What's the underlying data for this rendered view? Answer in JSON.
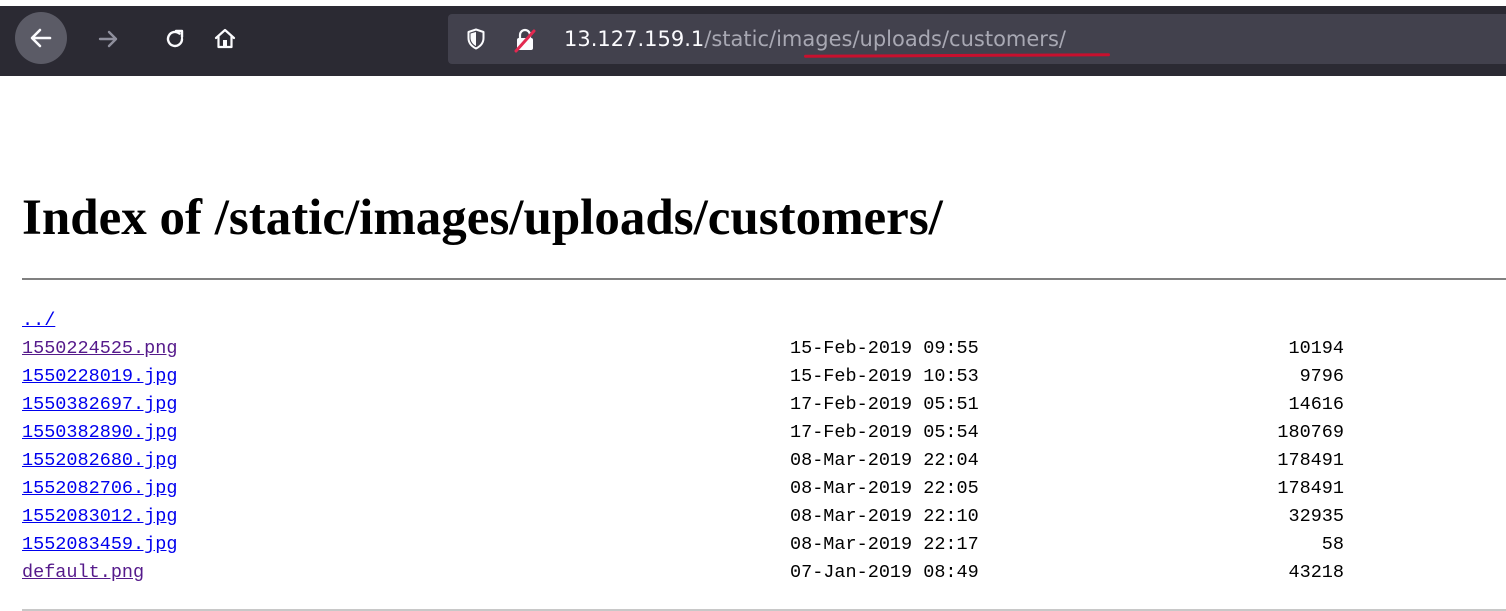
{
  "browser": {
    "url_host": "13.127.159.1",
    "url_path": "/static/images/uploads/customers/",
    "icons": {
      "back": "back-arrow-icon",
      "forward": "forward-arrow-icon",
      "reload": "reload-icon",
      "home": "home-icon",
      "tracking": "shield-icon",
      "security": "broken-lock-icon"
    }
  },
  "page": {
    "title": "Index of /static/images/uploads/customers/",
    "parent_link": "../",
    "files": [
      {
        "name": "1550224525.png",
        "date": "15-Feb-2019 09:55",
        "size": "10194",
        "visited": true
      },
      {
        "name": "1550228019.jpg",
        "date": "15-Feb-2019 10:53",
        "size": "9796",
        "visited": false
      },
      {
        "name": "1550382697.jpg",
        "date": "17-Feb-2019 05:51",
        "size": "14616",
        "visited": false
      },
      {
        "name": "1550382890.jpg",
        "date": "17-Feb-2019 05:54",
        "size": "180769",
        "visited": false
      },
      {
        "name": "1552082680.jpg",
        "date": "08-Mar-2019 22:04",
        "size": "178491",
        "visited": false
      },
      {
        "name": "1552082706.jpg",
        "date": "08-Mar-2019 22:05",
        "size": "178491",
        "visited": false
      },
      {
        "name": "1552083012.jpg",
        "date": "08-Mar-2019 22:10",
        "size": "32935",
        "visited": false
      },
      {
        "name": "1552083459.jpg",
        "date": "08-Mar-2019 22:17",
        "size": "58",
        "visited": false
      },
      {
        "name": "default.png",
        "date": "07-Jan-2019 08:49",
        "size": "43218",
        "visited": true
      }
    ]
  },
  "colors": {
    "toolbar_bg": "#2b2a33",
    "urlbar_bg": "#42414d",
    "link": "#0000ee",
    "link_visited": "#551a8b",
    "annotation_underline": "#c8102e"
  }
}
